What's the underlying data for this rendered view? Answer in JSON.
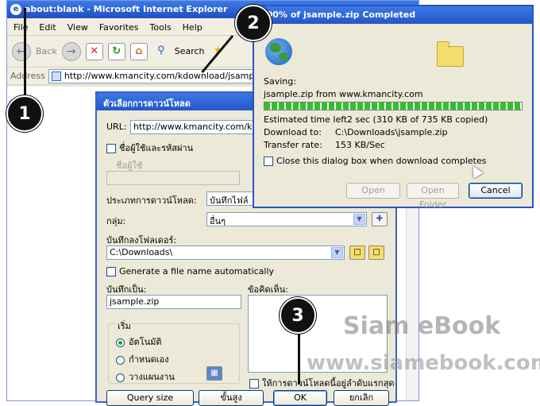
{
  "ie": {
    "title": "about:blank - Microsoft Internet Explorer",
    "logo_icon": "ie-logo-icon",
    "menu": [
      "File",
      "Edit",
      "View",
      "Favorites",
      "Tools",
      "Help"
    ],
    "toolbar": {
      "back_label": "Back",
      "search_label": "Search"
    },
    "address_label": "Address",
    "address_value": "http://www.kmancity.com/kdownload/jsample.zip"
  },
  "options_dialog": {
    "title": "ตัวเลือกการดาวน์โหลด",
    "url_label": "URL:",
    "url_value": "http://www.kmancity.com/kdownload/jsample.zip",
    "login_checkbox_label": "ชื่อผู้ใช้และรหัสผ่าน",
    "username_label": "ชื่อผู้ใช้",
    "download_type_label": "ประเภทการดาวน์โหลด:",
    "download_type_value": "บันทึกไฟล์",
    "category_label": "กลุ่ม:",
    "category_value": "อื่นๆ",
    "save_folder_label": "บันทึกลงโฟลเดอร์:",
    "save_folder_value": "C:\\Downloads\\",
    "auto_name_label": "Generate a file name automatically",
    "save_as_label": "บันทึกเป็น:",
    "save_as_value": "jsample.zip",
    "comment_label": "ข้อคิดเห็น:",
    "start_group_label": "เริ่ม",
    "start_options": [
      "อัตโนมัติ",
      "กำหนดเอง",
      "วางแผนงาน"
    ],
    "queue_top_label": "ให้การดาวน์โหลดนี้อยู่ลำดับแรกสุด",
    "buttons": {
      "query_size": "Query size",
      "advanced": "ขั้นสูง",
      "ok": "OK",
      "cancel": "ยกเลิก"
    }
  },
  "download_dialog": {
    "title": "100% of jsample.zip Completed",
    "saving_label": "Saving:",
    "saving_file": "jsample.zip from www.kmancity.com",
    "progress_fraction": 1.0,
    "estimated_label": "Estimated time left",
    "estimated_value": "2 sec (310 KB of 735 KB copied)",
    "download_to_label": "Download to:",
    "download_to_value": "C:\\Downloads\\jsample.zip",
    "transfer_label": "Transfer rate:",
    "transfer_value": "153 KB/Sec",
    "close_checkbox_label": "Close this dialog box when download completes",
    "buttons": {
      "open": "Open",
      "open_folder": "Open Folder",
      "cancel": "Cancel"
    }
  },
  "callouts": [
    "1",
    "2",
    "3"
  ],
  "watermark": {
    "line1": "Siam eBook",
    "line2": "www.siamebook.com"
  }
}
